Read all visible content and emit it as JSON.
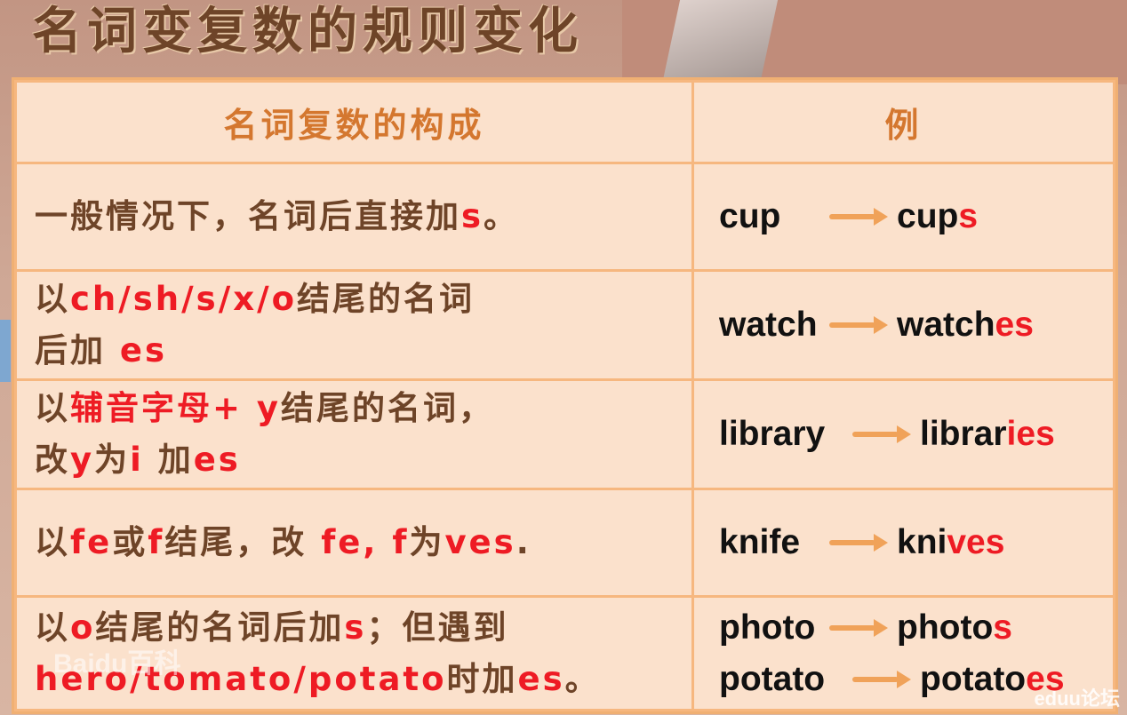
{
  "title": "名词变复数的规则变化",
  "table": {
    "headers": [
      "名词复数的构成",
      "例"
    ],
    "rows": [
      {
        "rule_lines": [
          [
            {
              "t": "一般情况下，名词后直接加",
              "red": false
            },
            {
              "t": "s",
              "red": true
            },
            {
              "t": "。",
              "red": false
            }
          ]
        ],
        "examples": [
          {
            "from": "cup",
            "to_base": "cup",
            "to_suffix": "s"
          }
        ]
      },
      {
        "rule_lines": [
          [
            {
              "t": "以",
              "red": false
            },
            {
              "t": "ch/sh/s/x/o",
              "red": true
            },
            {
              "t": "结尾的名词",
              "red": false
            }
          ],
          [
            {
              "t": "后加 ",
              "red": false
            },
            {
              "t": "es",
              "red": true
            }
          ]
        ],
        "examples": [
          {
            "from": "watch",
            "to_base": "watch",
            "to_suffix": "es"
          }
        ]
      },
      {
        "rule_lines": [
          [
            {
              "t": "以",
              "red": false
            },
            {
              "t": "辅音字母+ y",
              "red": true
            },
            {
              "t": "结尾的名词，",
              "red": false
            }
          ],
          [
            {
              "t": "改",
              "red": false
            },
            {
              "t": "y",
              "red": true
            },
            {
              "t": "为",
              "red": false
            },
            {
              "t": "i",
              "red": true
            },
            {
              "t": " 加",
              "red": false
            },
            {
              "t": "es",
              "red": true
            }
          ]
        ],
        "examples": [
          {
            "from": "library",
            "to_base": "librar",
            "to_suffix": "ies"
          }
        ]
      },
      {
        "rule_lines": [
          [
            {
              "t": "以",
              "red": false
            },
            {
              "t": "fe",
              "red": true
            },
            {
              "t": "或",
              "red": false
            },
            {
              "t": "f",
              "red": true
            },
            {
              "t": "结尾，改 ",
              "red": false
            },
            {
              "t": "fe, f",
              "red": true
            },
            {
              "t": "为",
              "red": false
            },
            {
              "t": "ves",
              "red": true
            },
            {
              "t": ".",
              "red": false
            }
          ]
        ],
        "examples": [
          {
            "from": "knife",
            "to_base": "kni",
            "to_suffix": "ves"
          }
        ]
      },
      {
        "rule_lines": [
          [
            {
              "t": "以",
              "red": false
            },
            {
              "t": "o",
              "red": true
            },
            {
              "t": "结尾的名词后加",
              "red": false
            },
            {
              "t": "s",
              "red": true
            },
            {
              "t": "；但遇到",
              "red": false
            }
          ],
          [
            {
              "t": "hero/tomato/potato",
              "red": true
            },
            {
              "t": "时加",
              "red": false
            },
            {
              "t": "es",
              "red": true
            },
            {
              "t": "。",
              "red": false
            }
          ]
        ],
        "examples": [
          {
            "from": "photo",
            "to_base": "photo",
            "to_suffix": "s"
          },
          {
            "from": "potato",
            "to_base": "potato",
            "to_suffix": "es"
          }
        ]
      }
    ]
  },
  "watermarks": {
    "baidu": "Baidu百科",
    "eduu": "eduu论坛"
  },
  "colors": {
    "rule_text": "#6e4428",
    "highlight": "#ee1b24",
    "header": "#d4772f",
    "arrow": "#f0a259",
    "cell_bg": "#fbe1cc",
    "border": "#f6b77f"
  }
}
